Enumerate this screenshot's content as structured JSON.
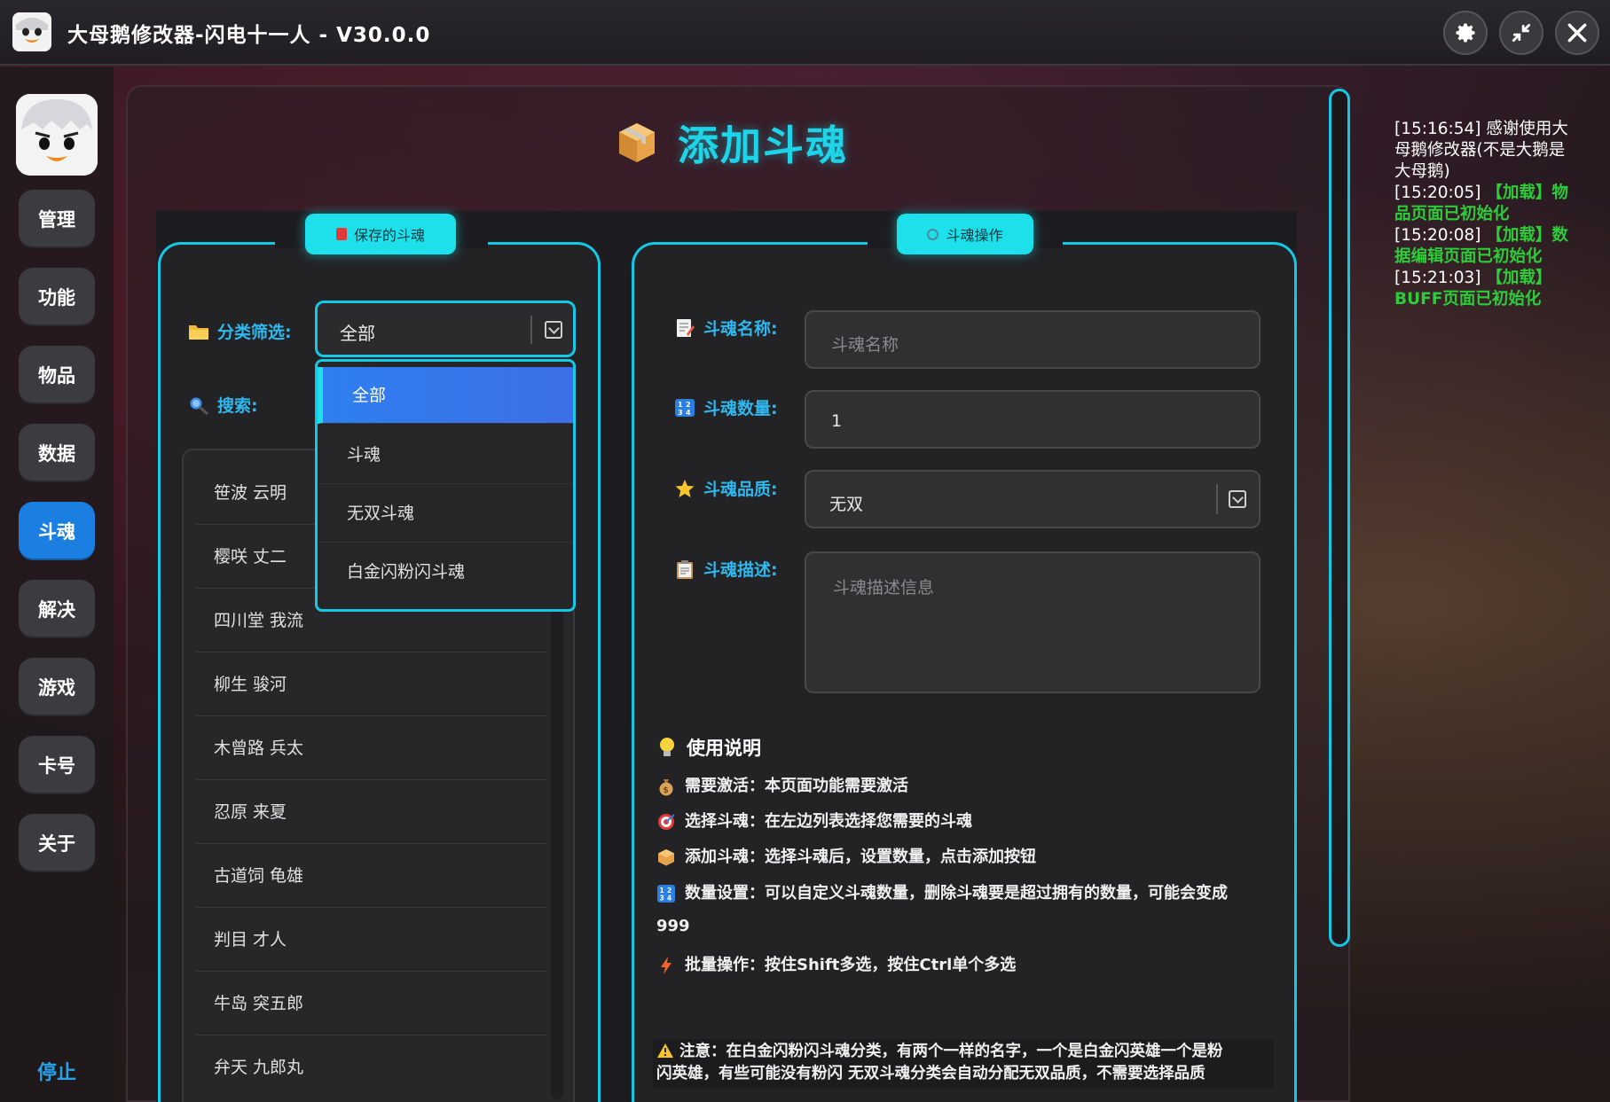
{
  "window": {
    "title": "大母鹅修改器-闪电十一人 - V30.0.0",
    "buttons": {
      "settings": "settings-icon",
      "minimize": "shrink-icon",
      "close": "close-icon"
    }
  },
  "sidebar": {
    "items": [
      {
        "label": "管理",
        "active": false
      },
      {
        "label": "功能",
        "active": false
      },
      {
        "label": "物品",
        "active": false
      },
      {
        "label": "数据",
        "active": false
      },
      {
        "label": "斗魂",
        "active": true
      },
      {
        "label": "解决",
        "active": false
      },
      {
        "label": "游戏",
        "active": false
      },
      {
        "label": "卡号",
        "active": false
      },
      {
        "label": "关于",
        "active": false
      }
    ],
    "stop_label": "停止"
  },
  "page": {
    "title": "添加斗魂"
  },
  "left_panel": {
    "tab_label": "保存的斗魂",
    "filter_label": "分类筛选:",
    "filter_value": "全部",
    "search_label": "搜索:",
    "dropdown_options": [
      "全部",
      "斗魂",
      "无双斗魂",
      "白金闪粉闪斗魂"
    ],
    "dropdown_selected": "全部",
    "list": [
      "笹波 云明",
      "樱咲 丈二",
      "四川堂 我流",
      "柳生 骏河",
      "木曾路 兵太",
      "忍原 来夏",
      "古道饲 龟雄",
      "判目 才人",
      "牛岛 突五郎",
      "弁天 九郎丸"
    ]
  },
  "right_panel": {
    "tab_label": "斗魂操作",
    "name_label": "斗魂名称:",
    "name_placeholder": "斗魂名称",
    "count_label": "斗魂数量:",
    "count_value": "1",
    "quality_label": "斗魂品质:",
    "quality_value": "无双",
    "desc_label": "斗魂描述:",
    "desc_placeholder": "斗魂描述信息",
    "help_title": "使用说明",
    "help_lines": [
      "需要激活：本页面功能需要激活",
      "选择斗魂：在左边列表选择您需要的斗魂",
      "添加斗魂：选择斗魂后，设置数量，点击添加按钮",
      "数量设置：可以自定义斗魂数量，删除斗魂要是超过拥有的数量，可能会变成",
      "批量操作：按住Shift多选，按住Ctrl单个多选"
    ],
    "help_continuation": "999",
    "notice_line1": "注意：在白金闪粉闪斗魂分类，有两个一样的名字，一个是白金闪英雄一个是粉",
    "notice_line2": "闪英雄，有些可能没有粉闪 无双斗魂分类会自动分配无双品质，不需要选择品质"
  },
  "log": [
    {
      "time": "[15:16:54]",
      "text": "感谢使用大母鹅修改器(不是大鹅是大母鹅)",
      "green": false
    },
    {
      "time": "[15:20:05]",
      "text": "【加载】物品页面已初始化",
      "green": true
    },
    {
      "time": "[15:20:08]",
      "text": "【加载】数据编辑页面已初始化",
      "green": true
    },
    {
      "time": "[15:21:03]",
      "text": "【加载】BUFF页面已初始化",
      "green": true
    }
  ]
}
